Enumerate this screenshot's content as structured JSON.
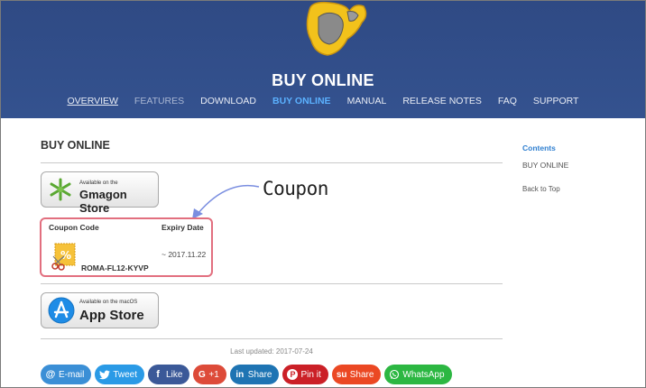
{
  "header": {
    "title": "BUY ONLINE",
    "nav": [
      {
        "label": "OVERVIEW"
      },
      {
        "label": "FEATURES"
      },
      {
        "label": "DOWNLOAD"
      },
      {
        "label": "BUY ONLINE"
      },
      {
        "label": "MANUAL"
      },
      {
        "label": "RELEASE NOTES"
      },
      {
        "label": "FAQ"
      },
      {
        "label": "SUPPORT"
      }
    ]
  },
  "main": {
    "heading": "BUY ONLINE",
    "gmagon_badge": {
      "small": "Available on the",
      "big": "Gmagon Store"
    },
    "coupon": {
      "code_header": "Coupon Code",
      "expiry_header": "Expiry Date",
      "code": "ROMA-FL12-KYVP",
      "expiry": "~ 2017.11.22"
    },
    "callout": "Coupon",
    "appstore_badge": {
      "small": "Available on the macOS",
      "big": "App Store"
    },
    "last_updated": "Last updated: 2017-07-24"
  },
  "toc": {
    "title": "Contents",
    "items": [
      "BUY ONLINE"
    ],
    "back": "Back to Top"
  },
  "share": [
    {
      "label": "E-mail",
      "icon": "at-icon",
      "color": "#3b8fd6"
    },
    {
      "label": "Tweet",
      "icon": "twitter-icon",
      "color": "#2a9ae6"
    },
    {
      "label": "Like",
      "icon": "facebook-icon",
      "color": "#3b5998"
    },
    {
      "label": "+1",
      "icon": "google-plus-icon",
      "color": "#dd4b39"
    },
    {
      "label": "Share",
      "icon": "linkedin-icon",
      "color": "#1e74b3"
    },
    {
      "label": "Pin it",
      "icon": "pinterest-icon",
      "color": "#cb2027"
    },
    {
      "label": "Share",
      "icon": "stumbleupon-icon",
      "color": "#eb4823"
    },
    {
      "label": "WhatsApp",
      "icon": "whatsapp-icon",
      "color": "#2cb742"
    }
  ],
  "colors": {
    "header": "#34528f",
    "active_nav": "#5bb1ff",
    "coupon_border": "#e26f7f"
  }
}
